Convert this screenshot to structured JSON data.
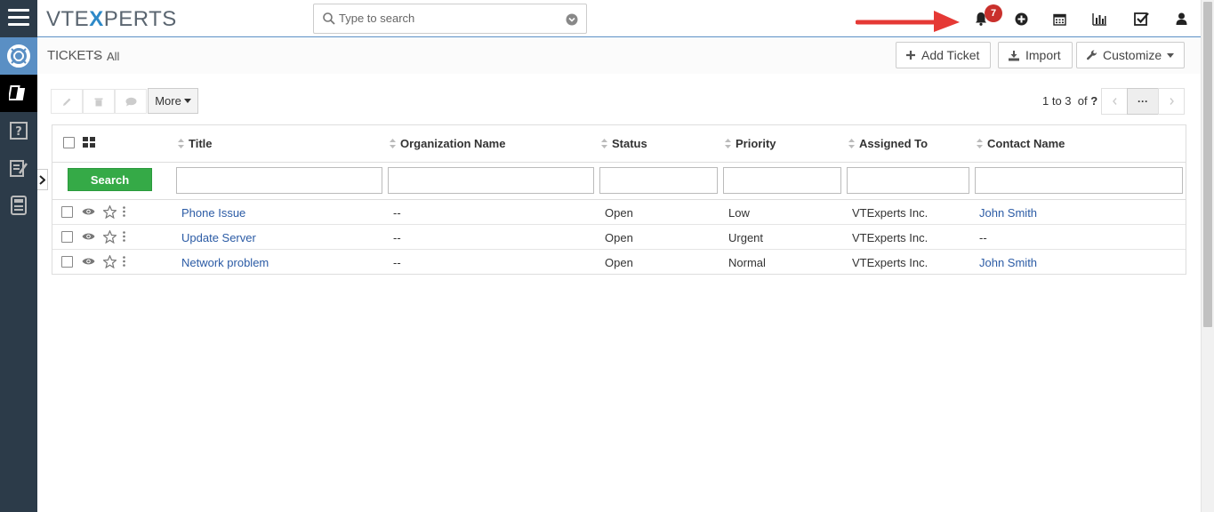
{
  "app": {
    "logo_prefix": "VTE",
    "logo_x": "X",
    "logo_suffix": "PERTS",
    "search_placeholder": "Type to search",
    "notification_count": "7"
  },
  "breadcrumb": {
    "module": "TICKETS",
    "separator": ">",
    "view": "All"
  },
  "actions": {
    "add_ticket": "Add Ticket",
    "import": "Import",
    "customize": "Customize"
  },
  "toolbar": {
    "more_label": "More",
    "pager_text": "1 to 3",
    "pager_of": "of",
    "pager_total": "?",
    "pager_menu": "···"
  },
  "table": {
    "columns": [
      "Title",
      "Organization Name",
      "Status",
      "Priority",
      "Assigned To",
      "Contact Name"
    ],
    "search_label": "Search",
    "rows": [
      {
        "title": "Phone Issue",
        "org": "--",
        "status": "Open",
        "priority": "Low",
        "assigned": "VTExperts Inc.",
        "contact": "John Smith"
      },
      {
        "title": "Update Server",
        "org": "--",
        "status": "Open",
        "priority": "Urgent",
        "assigned": "VTExperts Inc.",
        "contact": "--"
      },
      {
        "title": "Network problem",
        "org": "--",
        "status": "Open",
        "priority": "Normal",
        "assigned": "VTExperts Inc.",
        "contact": "John Smith"
      }
    ]
  },
  "colors": {
    "sidebar": "#2c3b49",
    "accent": "#5a8fc4",
    "search_button": "#35aa47",
    "badge": "#c9302c",
    "link": "#2b5ba5",
    "annotation_arrow": "#e53935"
  }
}
